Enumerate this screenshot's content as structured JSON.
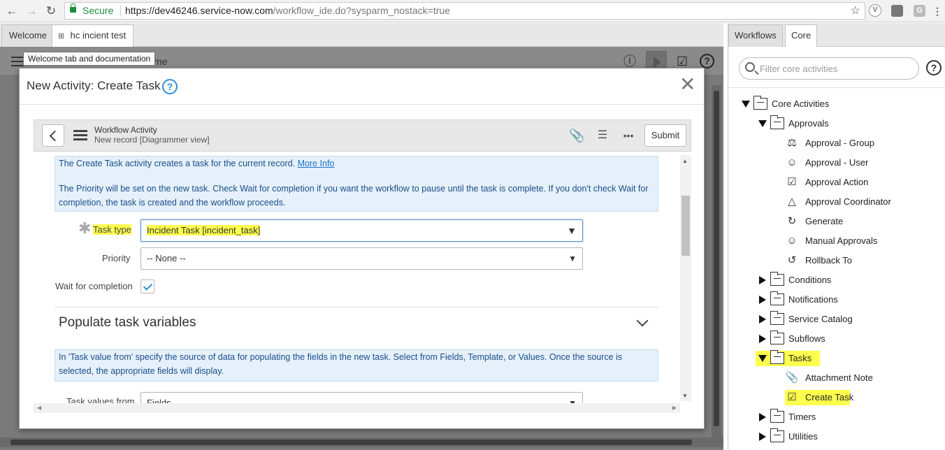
{
  "browser": {
    "secure_label": "Secure",
    "url_host": "https://dev46246.service-now.com",
    "url_path": "/workflow_ide.do?sysparm_nostack=true"
  },
  "tabs": [
    {
      "label": "Welcome"
    },
    {
      "label": "hc incient test"
    }
  ],
  "tooltip": "Welcome tab and documentation",
  "canvas": {
    "partial_title": "me"
  },
  "modal": {
    "title": "New Activity: Create Task",
    "form_title": "Workflow Activity",
    "form_subtitle": "New record [Diagrammer view]",
    "submit_label": "Submit",
    "info_line1": "The Create Task activity creates a task for the current record. ",
    "more_info": "More Info",
    "info_line2": "The Priority will be set on the new task. Check Wait for completion if you want the workflow to pause until the task is complete. If you don't check Wait for completion, the task is created and the workflow proceeds.",
    "task_type_label": "Task type",
    "task_type_value": "Incident Task [incident_task]",
    "priority_label": "Priority",
    "priority_value": "-- None --",
    "wait_label": "Wait for completion",
    "wait_checked": true,
    "section_title": "Populate task variables",
    "info2": "In 'Task value from' specify the source of data for populating the fields in the new task. Select from Fields, Template, or Values. Once the source is selected, the appropriate fields will display.",
    "task_values_label": "Task values from",
    "task_values_value": "Fields"
  },
  "right_panel": {
    "tabs": [
      {
        "label": "Workflows"
      },
      {
        "label": "Core"
      }
    ],
    "filter_placeholder": "Filter core activities",
    "tree": {
      "root": "Core Activities",
      "approvals": "Approvals",
      "approval_items": [
        "Approval - Group",
        "Approval - User",
        "Approval Action",
        "Approval Coordinator",
        "Generate",
        "Manual Approvals",
        "Rollback To"
      ],
      "folders_mid": [
        "Conditions",
        "Notifications",
        "Service Catalog",
        "Subflows"
      ],
      "tasks": "Tasks",
      "task_items": [
        "Attachment Note",
        "Create Task"
      ],
      "folders_end": [
        "Timers",
        "Utilities"
      ]
    }
  },
  "colors": {
    "highlight": "#ffff4d",
    "accent": "#2f8ed8",
    "secure": "#1e8e3e"
  }
}
